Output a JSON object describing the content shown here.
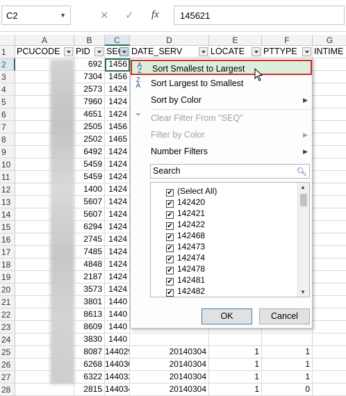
{
  "formula_bar": {
    "name_box": "C2",
    "cancel_icon": "✕",
    "enter_icon": "✓",
    "function_icon": "fx",
    "value": "145621"
  },
  "columns": [
    "A",
    "B",
    "C",
    "D",
    "E",
    "F",
    "G"
  ],
  "header_row": {
    "A": "PCUCODE",
    "B": "PID",
    "C": "SEQ",
    "D": "DATE_SERV",
    "E": "LOCATE",
    "F": "PTTYPE",
    "G": "INTIME"
  },
  "rows": [
    {
      "n": "1"
    },
    {
      "n": "2",
      "B": "692",
      "C": "1456"
    },
    {
      "n": "3",
      "B": "7304",
      "C": "1456"
    },
    {
      "n": "4",
      "B": "2573",
      "C": "1424"
    },
    {
      "n": "5",
      "B": "7960",
      "C": "1424"
    },
    {
      "n": "6",
      "B": "4651",
      "C": "1424"
    },
    {
      "n": "7",
      "B": "2505",
      "C": "1456"
    },
    {
      "n": "8",
      "B": "2502",
      "C": "1465"
    },
    {
      "n": "9",
      "B": "6492",
      "C": "1424"
    },
    {
      "n": "10",
      "B": "5459",
      "C": "1424"
    },
    {
      "n": "11",
      "B": "5459",
      "C": "1424"
    },
    {
      "n": "12",
      "B": "1400",
      "C": "1424"
    },
    {
      "n": "13",
      "B": "5607",
      "C": "1424"
    },
    {
      "n": "14",
      "B": "5607",
      "C": "1424"
    },
    {
      "n": "15",
      "B": "6294",
      "C": "1424"
    },
    {
      "n": "16",
      "B": "2745",
      "C": "1424"
    },
    {
      "n": "17",
      "B": "7485",
      "C": "1424"
    },
    {
      "n": "18",
      "B": "4848",
      "C": "1424"
    },
    {
      "n": "19",
      "B": "2187",
      "C": "1424"
    },
    {
      "n": "20",
      "B": "3573",
      "C": "1424"
    },
    {
      "n": "21",
      "B": "3801",
      "C": "1440"
    },
    {
      "n": "22",
      "B": "8613",
      "C": "1440"
    },
    {
      "n": "23",
      "B": "8609",
      "C": "1440"
    },
    {
      "n": "24",
      "B": "3830",
      "C": "1440"
    },
    {
      "n": "25",
      "B": "8087",
      "C": "144029",
      "D": "20140304",
      "E": "1",
      "F": "1"
    },
    {
      "n": "26",
      "B": "6268",
      "C": "144030",
      "D": "20140304",
      "E": "1",
      "F": "1"
    },
    {
      "n": "27",
      "B": "6322",
      "C": "144032",
      "D": "20140304",
      "E": "1",
      "F": "1"
    },
    {
      "n": "28",
      "B": "2815",
      "C": "144034",
      "D": "20140304",
      "E": "1",
      "F": "0"
    }
  ],
  "menu": {
    "items": [
      {
        "label": "Sort Smallest to Largest",
        "enabled": true,
        "icon": "sort-ascending-icon",
        "highlighted": true
      },
      {
        "label": "Sort Largest to Smallest",
        "enabled": true,
        "icon": "sort-descending-icon"
      },
      {
        "label": "Sort by Color",
        "enabled": true,
        "submenu": true
      },
      {
        "label": "Clear Filter From \"SEQ\"",
        "enabled": false,
        "icon": "clear-filter-icon"
      },
      {
        "label": "Filter by Color",
        "enabled": false,
        "submenu": true
      },
      {
        "label": "Number Filters",
        "enabled": true,
        "submenu": true
      }
    ],
    "search_placeholder": "Search",
    "checklist": [
      "(Select All)",
      "142420",
      "142421",
      "142422",
      "142468",
      "142473",
      "142474",
      "142478",
      "142481",
      "142482"
    ],
    "ok_label": "OK",
    "cancel_label": "Cancel"
  },
  "colors": {
    "accent": "#217346",
    "highlight_border": "#cc2d2d",
    "highlight_fill": "#dcefdc"
  }
}
